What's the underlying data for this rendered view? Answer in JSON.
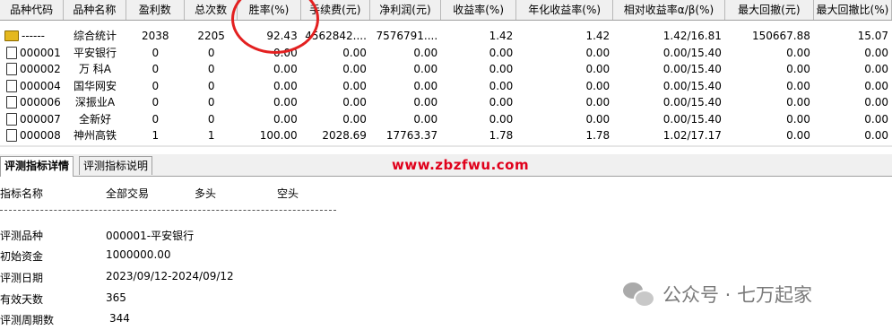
{
  "table": {
    "headers": [
      "品种代码",
      "品种名称",
      "盈利数",
      "总次数",
      "胜率(%)",
      "手续费(元)",
      "净利润(元)",
      "收益率(%)",
      "年化收益率(%)",
      "相对收益率α/β(%)",
      "最大回撤(元)",
      "最大回撤比(%)"
    ],
    "rows": [
      [
        "------",
        "综合统计",
        "2038",
        "2205",
        "92.43",
        "4562842....",
        "7576791....",
        "1.42",
        "1.42",
        "1.42/16.81",
        "150667.88",
        "15.07"
      ],
      [
        "000001",
        "平安银行",
        "0",
        "0",
        "0.00",
        "0.00",
        "0.00",
        "0.00",
        "0.00",
        "0.00/15.40",
        "0.00",
        "0.00"
      ],
      [
        "000002",
        "万 科A",
        "0",
        "0",
        "0.00",
        "0.00",
        "0.00",
        "0.00",
        "0.00",
        "0.00/15.40",
        "0.00",
        "0.00"
      ],
      [
        "000004",
        "国华网安",
        "0",
        "0",
        "0.00",
        "0.00",
        "0.00",
        "0.00",
        "0.00",
        "0.00/15.40",
        "0.00",
        "0.00"
      ],
      [
        "000006",
        "深振业A",
        "0",
        "0",
        "0.00",
        "0.00",
        "0.00",
        "0.00",
        "0.00",
        "0.00/15.40",
        "0.00",
        "0.00"
      ],
      [
        "000007",
        "全新好",
        "0",
        "0",
        "0.00",
        "0.00",
        "0.00",
        "0.00",
        "0.00",
        "0.00/15.40",
        "0.00",
        "0.00"
      ],
      [
        "000008",
        "神州高铁",
        "1",
        "1",
        "100.00",
        "2028.69",
        "17763.37",
        "1.78",
        "1.78",
        "1.02/17.17",
        "0.00",
        "0.00"
      ]
    ]
  },
  "tabs": [
    {
      "label": "评测指标详情",
      "active": true
    },
    {
      "label": "评测指标说明",
      "active": false
    }
  ],
  "watermark_url": "www.zbzfwu.com",
  "details": {
    "header": {
      "name": "指标名称",
      "all": "全部交易",
      "long": "多头",
      "short": "空头"
    },
    "items": [
      {
        "label": "评测品种",
        "value": "000001-平安银行"
      },
      {
        "label": "初始资金",
        "value": "1000000.00"
      },
      {
        "label": "评测日期",
        "value": "2023/09/12-2024/09/12"
      },
      {
        "label": "有效天数",
        "value": "365"
      },
      {
        "label": "评测周期数",
        "value": "344"
      }
    ]
  },
  "wechat_watermark": "公众号 · 七万起家",
  "icons": {
    "summary_row": "folder-icon",
    "stock_row": "document-icon",
    "watermark": "wechat-icon"
  },
  "colors": {
    "annotation_circle": "#e32020",
    "url_watermark": "#e0001b"
  }
}
